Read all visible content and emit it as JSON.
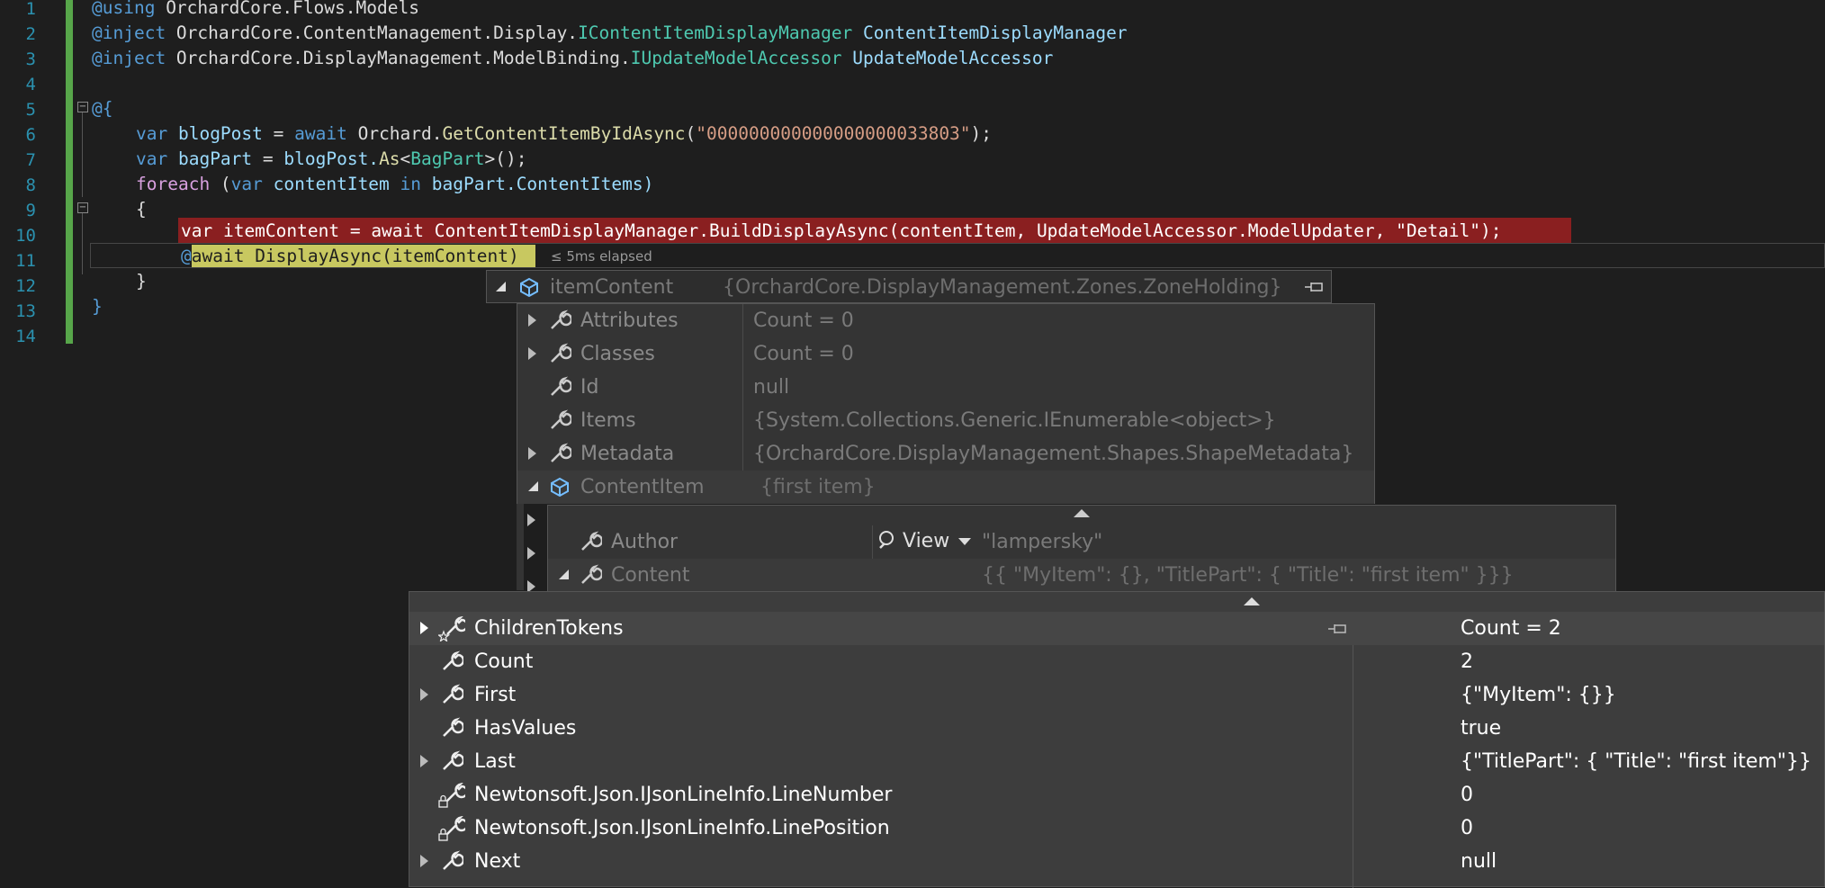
{
  "line_numbers": [
    "1",
    "2",
    "3",
    "4",
    "5",
    "6",
    "7",
    "8",
    "9",
    "10",
    "11",
    "12",
    "13",
    "14"
  ],
  "code": {
    "l1_kw": "@using",
    "l1_ns": " OrchardCore.Flows.Models",
    "l2_kw": "@inject",
    "l2_ns": " OrchardCore.ContentManagement.Display.",
    "l2_type": "IContentItemDisplayManager",
    "l2_prop": " ContentItemDisplayManager",
    "l3_kw": "@inject",
    "l3_ns": " OrchardCore.DisplayManagement.ModelBinding.",
    "l3_type": "IUpdateModelAccessor",
    "l3_prop": " UpdateModelAccessor",
    "l5": "@{",
    "l6_var": "var",
    "l6_name": " blogPost",
    "l6_eq": " = ",
    "l6_await": "await",
    "l6_orch": " Orchard.",
    "l6_fn": "GetContentItemByIdAsync",
    "l6_open": "(",
    "l6_str": "\"000000000000000000033803\"",
    "l6_close": ");",
    "l7_var": "var",
    "l7_name": " bagPart",
    "l7_eq": " = ",
    "l7_obj": "blogPost.",
    "l7_fn": "As",
    "l7_lt": "<",
    "l7_type": "BagPart",
    "l7_gt": ">();",
    "l8_foreach": "foreach",
    "l8_open": " (",
    "l8_var": "var",
    "l8_item": " contentItem",
    "l8_in": " in",
    "l8_rest": " bagPart.ContentItems)",
    "l9": "{",
    "l10": "var itemContent = await ContentItemDisplayManager.BuildDisplayAsync(contentItem, UpdateModelAccessor.ModelUpdater, \"Detail\");",
    "l11_at": "@",
    "l11_rest": "await DisplayAsync(itemContent)",
    "l11_elapsed": "≤ 5ms elapsed",
    "l12": "}",
    "l13": "}"
  },
  "tip1": {
    "name": "itemContent",
    "value": "{OrchardCore.DisplayManagement.Zones.ZoneHolding}",
    "rows": [
      {
        "name": "Attributes",
        "value": "Count = 0"
      },
      {
        "name": "Classes",
        "value": "Count = 0"
      },
      {
        "name": "Id",
        "value": "null"
      },
      {
        "name": "Items",
        "value": "{System.Collections.Generic.IEnumerable<object>}"
      },
      {
        "name": "Metadata",
        "value": "{OrchardCore.DisplayManagement.Shapes.ShapeMetadata}"
      },
      {
        "name": "ContentItem",
        "value": "{first item}"
      }
    ]
  },
  "tip2": {
    "rows": [
      {
        "name": "Author",
        "view": "View",
        "value": "\"lampersky\""
      },
      {
        "name": "Content",
        "value": "{{  \"MyItem\": {},  \"TitlePart\": {    \"Title\": \"first item\"  }}}"
      }
    ]
  },
  "tip3": {
    "rows": [
      {
        "name": "ChildrenTokens",
        "value": "Count = 2"
      },
      {
        "name": "Count",
        "value": "2"
      },
      {
        "name": "First",
        "value": "{\"MyItem\": {}}"
      },
      {
        "name": "HasValues",
        "value": "true"
      },
      {
        "name": "Last",
        "value": "{\"TitlePart\": {  \"Title\": \"first item\"}}"
      },
      {
        "name": "Newtonsoft.Json.IJsonLineInfo.LineNumber",
        "value": "0"
      },
      {
        "name": "Newtonsoft.Json.IJsonLineInfo.LinePosition",
        "value": "0"
      },
      {
        "name": "Next",
        "value": "null"
      }
    ]
  },
  "colors": {
    "editor_bg": "#1e1e1e",
    "breakpoint": "#8a1f20",
    "exec": "#c8c860",
    "change": "#57a64a"
  }
}
